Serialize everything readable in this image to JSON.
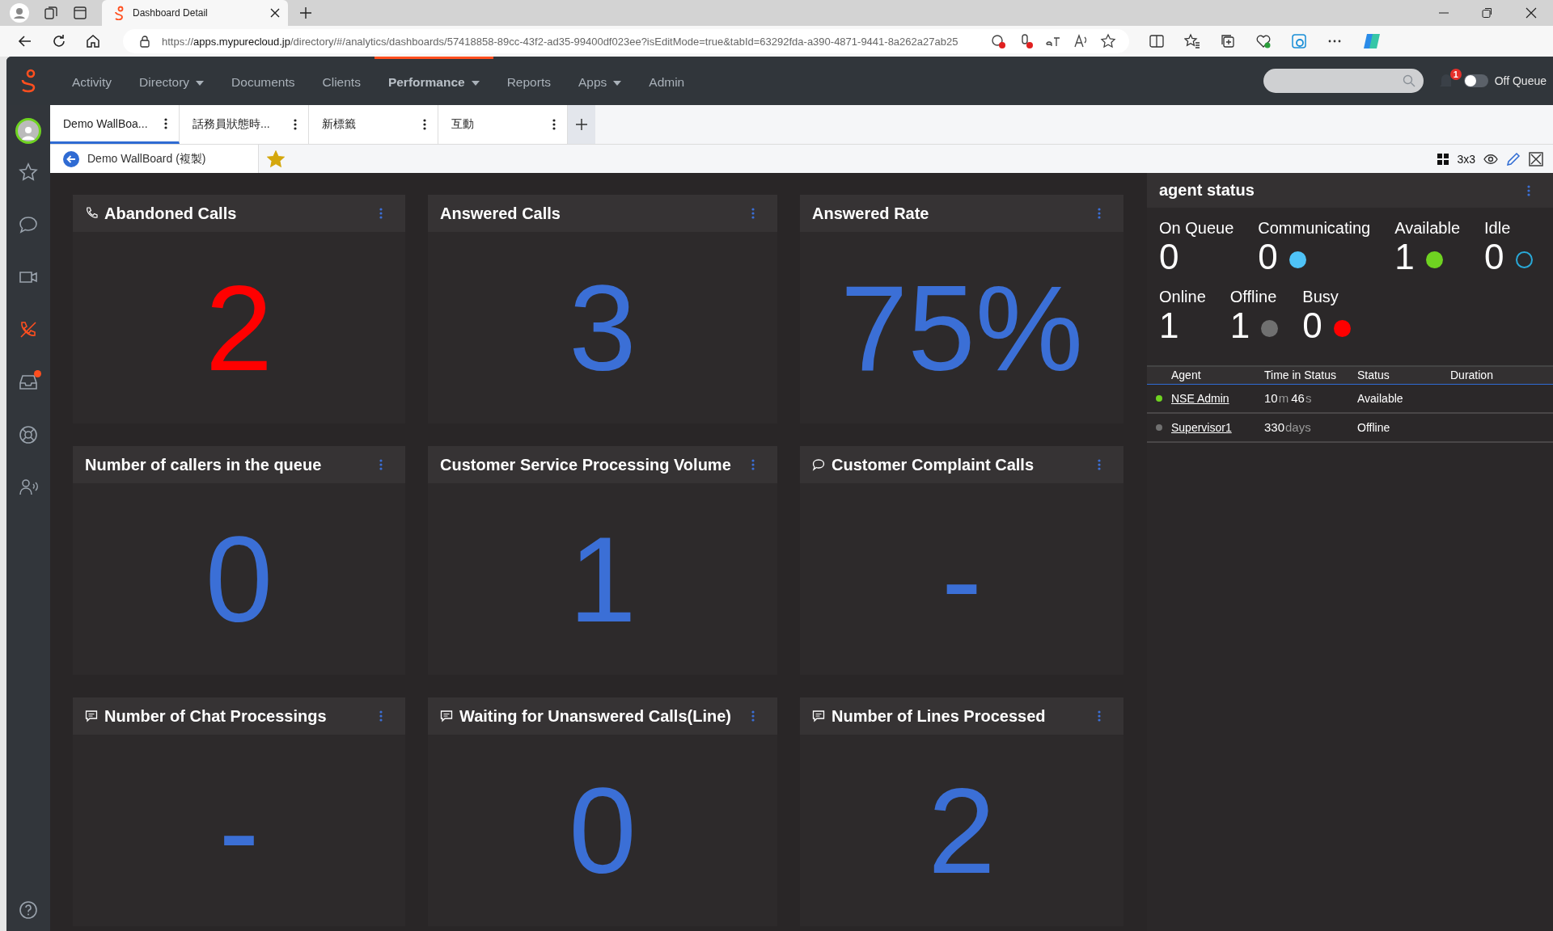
{
  "browser": {
    "tabs": [
      {
        "title": "Dashboard Detail",
        "selected": true
      }
    ],
    "url_scheme": "https://",
    "url_host": "apps.mypurecloud.jp",
    "url_path": "/directory/#/analytics/dashboards/57418858-89cc-43f2-ad35-99400df023ee?isEditMode=true&tabId=63292fda-a390-4871-9441-8a262a27ab25"
  },
  "nav": {
    "items": [
      {
        "label": "Activity",
        "selected": false,
        "dropdown": false
      },
      {
        "label": "Directory",
        "selected": false,
        "dropdown": true
      },
      {
        "label": "Documents",
        "selected": false,
        "dropdown": false
      },
      {
        "label": "Clients",
        "selected": false,
        "dropdown": false
      },
      {
        "label": "Performance",
        "selected": true,
        "dropdown": true
      },
      {
        "label": "Reports",
        "selected": false,
        "dropdown": false
      },
      {
        "label": "Apps",
        "selected": false,
        "dropdown": true
      },
      {
        "label": "Admin",
        "selected": false,
        "dropdown": false
      }
    ],
    "notifications": "1",
    "queue": {
      "label": "Off Queue",
      "on": false
    }
  },
  "sidebar": {
    "items": [
      {
        "kind": "star",
        "selected": false,
        "badge": false
      },
      {
        "kind": "chat",
        "selected": false,
        "badge": false
      },
      {
        "kind": "video",
        "selected": false,
        "badge": false
      },
      {
        "kind": "phone",
        "selected": true,
        "badge": false
      },
      {
        "kind": "inbox",
        "selected": false,
        "badge": true
      },
      {
        "kind": "lifebuoy",
        "selected": false,
        "badge": false
      },
      {
        "kind": "people",
        "selected": false,
        "badge": false
      }
    ]
  },
  "tabs": [
    {
      "label": "Demo WallBoa...",
      "selected": true
    },
    {
      "label": "話務員狀態時...",
      "selected": false
    },
    {
      "label": "新標籤",
      "selected": false
    },
    {
      "label": "互動",
      "selected": false
    }
  ],
  "breadcrumb": {
    "title": "Demo WallBoard (複製)",
    "favorite": true,
    "layout": "3x3"
  },
  "tiles": [
    {
      "title": "Abandoned Calls",
      "kind": "phone",
      "value": "2",
      "color": "#ff0000"
    },
    {
      "title": "Answered Calls",
      "kind": "plain",
      "value": "3",
      "color": "#3b6fd6"
    },
    {
      "title": "Answered Rate",
      "kind": "plain",
      "value": "75%",
      "color": "#3b6fd6"
    },
    {
      "title": "Number of callers in the queue",
      "kind": "plain",
      "value": "0",
      "color": "#3b6fd6"
    },
    {
      "title": "Customer Service Processing Volume",
      "kind": "plain",
      "value": "1",
      "color": "#3b6fd6"
    },
    {
      "title": "Customer Complaint Calls",
      "kind": "bubble",
      "value": "-",
      "color": "#3b6fd6"
    },
    {
      "title": "Number of Chat Processings",
      "kind": "message",
      "value": "-",
      "color": "#3b6fd6"
    },
    {
      "title": "Waiting for Unanswered Calls(Line)",
      "kind": "message",
      "value": "0",
      "color": "#3b6fd6"
    },
    {
      "title": "Number of Lines Processed",
      "kind": "message",
      "value": "2",
      "color": "#3b6fd6"
    }
  ],
  "agent_status": {
    "title": "agent status",
    "stat_rows": [
      [
        {
          "label": "On Queue",
          "value": "0",
          "kind": "none"
        },
        {
          "label": "Communicating",
          "value": "0",
          "kind": "dot",
          "color": "#4fc3f7"
        },
        {
          "label": "Available",
          "value": "1",
          "kind": "dot",
          "color": "#6fd321"
        },
        {
          "label": "Idle",
          "value": "0",
          "kind": "ring",
          "color": "#29a9d8"
        }
      ],
      [
        {
          "label": "Online",
          "value": "1",
          "kind": "none"
        },
        {
          "label": "Offline",
          "value": "1",
          "kind": "dot",
          "color": "#707070"
        },
        {
          "label": "Busy",
          "value": "0",
          "kind": "dot",
          "color": "#ff0000"
        }
      ]
    ],
    "columns": [
      "Agent",
      "Time in Status",
      "Status",
      "Duration"
    ],
    "rows": [
      {
        "color": "#6fd321",
        "agent": "NSE Admin",
        "time": [
          {
            "text": "10",
            "kind": "number"
          },
          {
            "text": "m",
            "kind": "unit"
          },
          {
            "text": "46",
            "kind": "number"
          },
          {
            "text": "s",
            "kind": "unit"
          }
        ],
        "status": "Available"
      },
      {
        "color": "#707070",
        "agent": "Supervisor1",
        "time": [
          {
            "text": "330",
            "kind": "number"
          },
          {
            "text": "days",
            "kind": "unit"
          }
        ],
        "status": "Offline"
      }
    ]
  }
}
